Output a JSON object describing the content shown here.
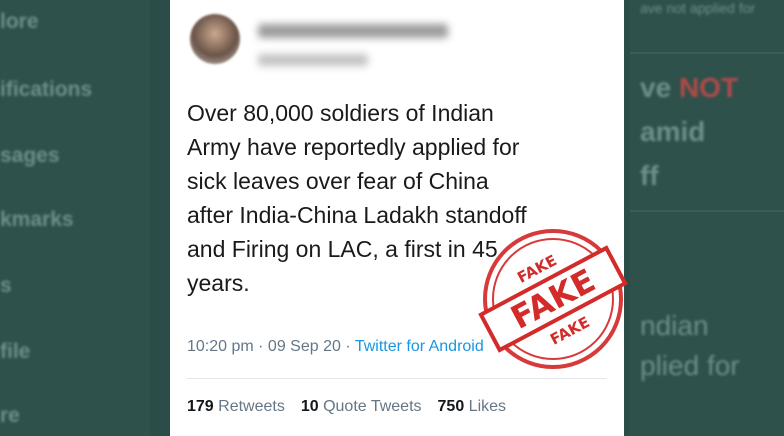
{
  "background": {
    "nav_items": [
      "lore",
      "ifications",
      "sages",
      "kmarks",
      "s",
      "file",
      "re"
    ],
    "right_snippets": {
      "top": "ave not applied for",
      "line1_prefix": "ve ",
      "line1_highlight": "NOT",
      "line2": "amid",
      "line3": "ff",
      "line4": "ndian",
      "line5": "plied for"
    }
  },
  "tweet": {
    "text_lines": [
      "Over 80,000 soldiers of Indian",
      "Army have reportedly applied for",
      "sick leaves over fear of China",
      "after India-China Ladakh standoff",
      "and Firing on LAC, a first in 45",
      "years."
    ],
    "time": "10:20 pm · 09 Sep 20 · ",
    "source": "Twitter for Android",
    "retweets_count": "179",
    "retweets_label": " Retweets",
    "quotes_count": "10",
    "quotes_label": " Quote Tweets",
    "likes_count": "750",
    "likes_label": " Likes"
  },
  "stamp": {
    "center": "FAKE",
    "top": "FAKE",
    "bottom": "FAKE",
    "color": "#d32a2a"
  }
}
